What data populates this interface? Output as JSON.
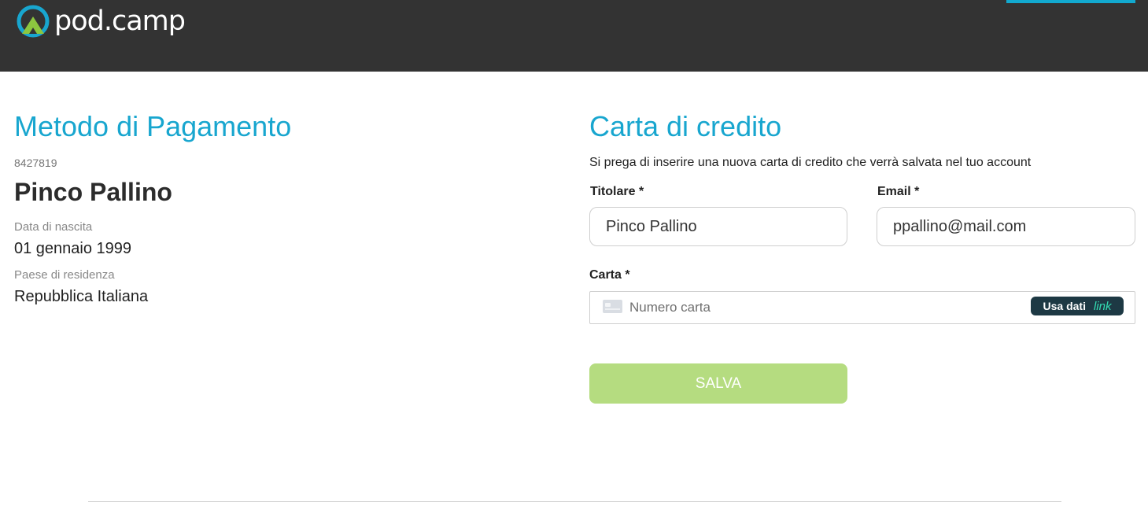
{
  "brand": {
    "name": "pod.camp"
  },
  "customer": {
    "section_title": "Metodo di Pagamento",
    "id": "8427819",
    "name": "Pinco Pallino",
    "dob_label": "Data di nascita",
    "dob_value": "01 gennaio 1999",
    "country_label": "Paese di residenza",
    "country_value": "Repubblica Italiana"
  },
  "card_form": {
    "section_title": "Carta di credito",
    "intro": "Si prega di inserire una nuova carta di credito che verrà salvata nel tuo account",
    "holder_label": "Titolare *",
    "holder_value": "Pinco Pallino",
    "email_label": "Email *",
    "email_value": "ppallino@mail.com",
    "card_label": "Carta *",
    "card_placeholder": "Numero carta",
    "link_button_prefix": "Usa dati",
    "link_button_brand": "link",
    "save_label": "SALVA"
  },
  "colors": {
    "header_bg": "#333333",
    "accent": "#18a6cf",
    "save_button": "#b5dc80",
    "link_button_bg": "#1d3944",
    "link_brand": "#33ddb3"
  },
  "icons": {
    "logo": "podcamp-logo-icon",
    "card": "credit-card-icon"
  }
}
